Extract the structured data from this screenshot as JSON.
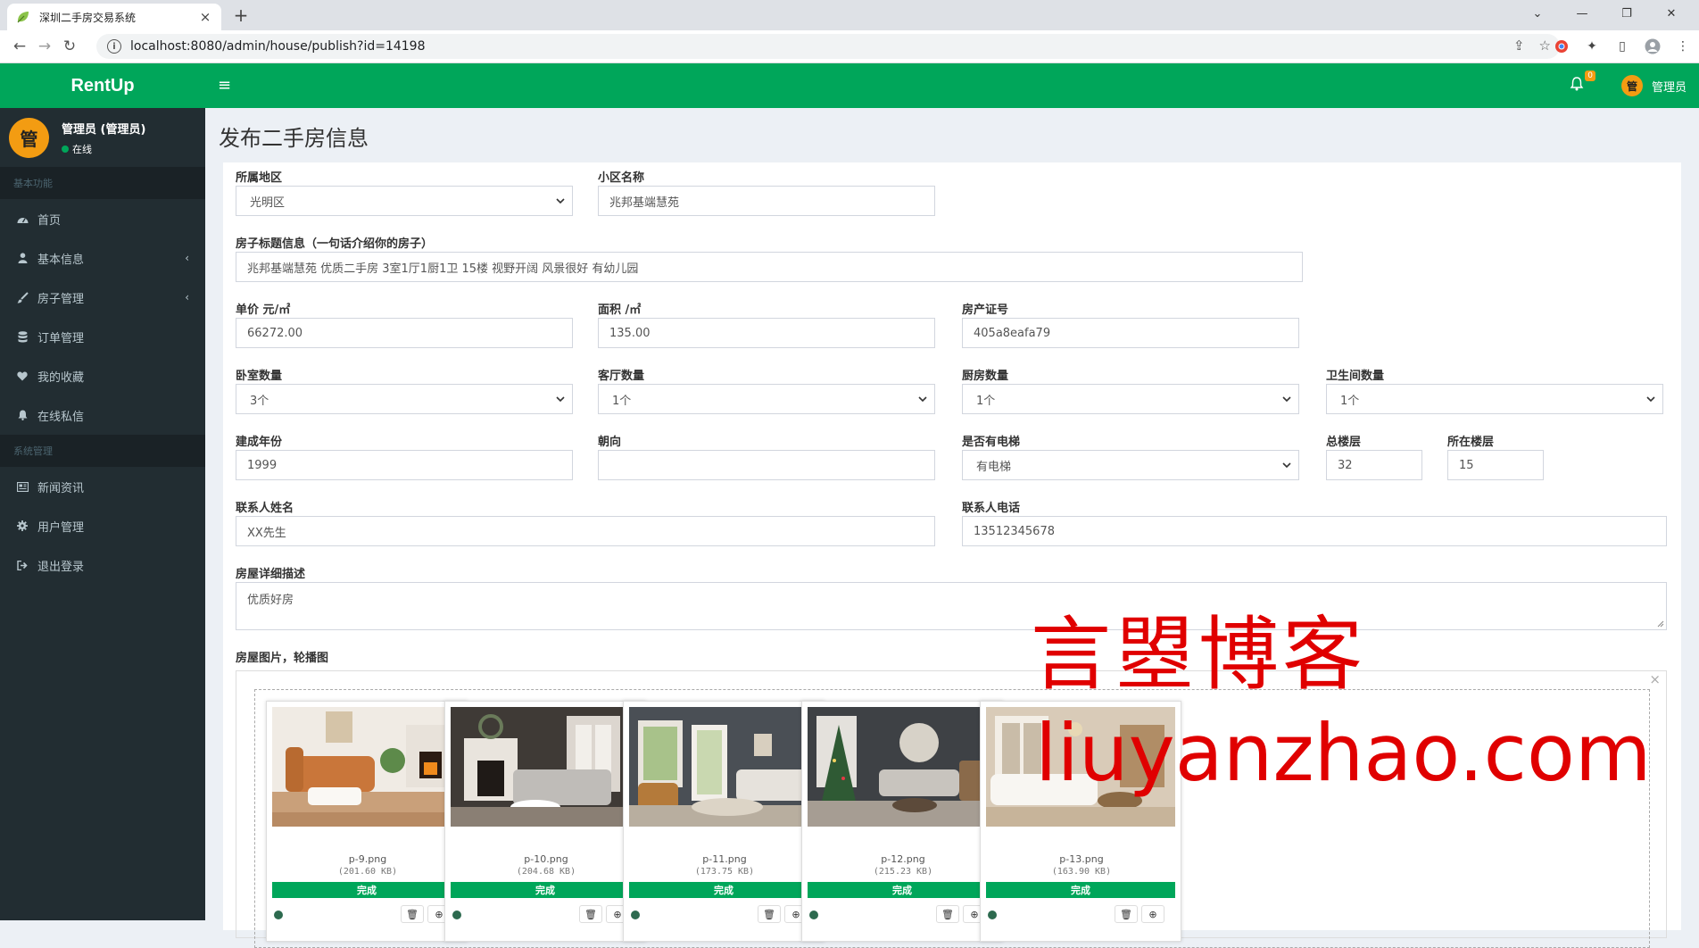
{
  "browser": {
    "tab_title": "深圳二手房交易系统",
    "tab_close": "×",
    "new_tab": "+",
    "url": "localhost:8080/admin/house/publish?id=14198",
    "win_min": "—",
    "win_restore": "❐",
    "win_close": "✕"
  },
  "header": {
    "logo": "RentUp",
    "menu_toggle": "≡",
    "notify_badge": "0",
    "user_avatar": "管",
    "user_name": "管理员"
  },
  "sidebar": {
    "avatar": "管",
    "user_name": "管理员 (管理员)",
    "user_status": "在线",
    "section_basic": "基本功能",
    "section_system": "系统管理",
    "items": [
      {
        "label": "首页",
        "icon": "dashboard-icon"
      },
      {
        "label": "基本信息",
        "icon": "user-icon"
      },
      {
        "label": "房子管理",
        "icon": "brush-icon"
      },
      {
        "label": "订单管理",
        "icon": "database-icon"
      },
      {
        "label": "我的收藏",
        "icon": "heart-icon"
      },
      {
        "label": "在线私信",
        "icon": "bell-icon"
      },
      {
        "label": "新闻资讯",
        "icon": "newspaper-icon"
      },
      {
        "label": "用户管理",
        "icon": "gear-icon"
      },
      {
        "label": "退出登录",
        "icon": "sign-out-icon"
      }
    ]
  },
  "page": {
    "title": "发布二手房信息"
  },
  "form": {
    "region": {
      "label": "所属地区",
      "value": "光明区"
    },
    "community": {
      "label": "小区名称",
      "value": "兆邦基端慧苑"
    },
    "house_title": {
      "label": "房子标题信息（一句话介绍你的房子）",
      "value": "兆邦基端慧苑 优质二手房 3室1厅1厨1卫 15楼 视野开阔 风景很好 有幼儿园"
    },
    "unit_price": {
      "label": "单价 元/㎡",
      "value": "66272.00"
    },
    "area": {
      "label": "面积 /㎡",
      "value": "135.00"
    },
    "cert_no": {
      "label": "房产证号",
      "value": "405a8eafa79"
    },
    "bedrooms": {
      "label": "卧室数量",
      "value": "3个"
    },
    "living_rooms": {
      "label": "客厅数量",
      "value": "1个"
    },
    "kitchens": {
      "label": "厨房数量",
      "value": "1个"
    },
    "bathrooms": {
      "label": "卫生间数量",
      "value": "1个"
    },
    "build_year": {
      "label": "建成年份",
      "value": "1999"
    },
    "orientation": {
      "label": "朝向",
      "value": ""
    },
    "elevator": {
      "label": "是否有电梯",
      "value": "有电梯"
    },
    "total_floors": {
      "label": "总楼层",
      "value": "32"
    },
    "floor": {
      "label": "所在楼层",
      "value": "15"
    },
    "contact_name": {
      "label": "联系人姓名",
      "value": "XX先生"
    },
    "contact_phone": {
      "label": "联系人电话",
      "value": "13512345678"
    },
    "description": {
      "label": "房屋详细描述",
      "value": "优质好房"
    },
    "images_label": "房屋图片，轮播图"
  },
  "upload": {
    "close": "×",
    "status_text": "完成",
    "files": [
      {
        "name": "p-9.png",
        "size": "(201.60 KB)"
      },
      {
        "name": "p-10.png",
        "size": "(204.68 KB)"
      },
      {
        "name": "p-11.png",
        "size": "(173.75 KB)"
      },
      {
        "name": "p-12.png",
        "size": "(215.23 KB)"
      },
      {
        "name": "p-13.png",
        "size": "(163.90 KB)"
      }
    ]
  },
  "watermark": {
    "cn": "言曌博客",
    "en": "liuyanzhao.com"
  },
  "colors": {
    "brand_green": "#00a65a",
    "sidebar_bg": "#222d32",
    "avatar_orange": "#f39c12",
    "watermark_red": "#e00000"
  }
}
